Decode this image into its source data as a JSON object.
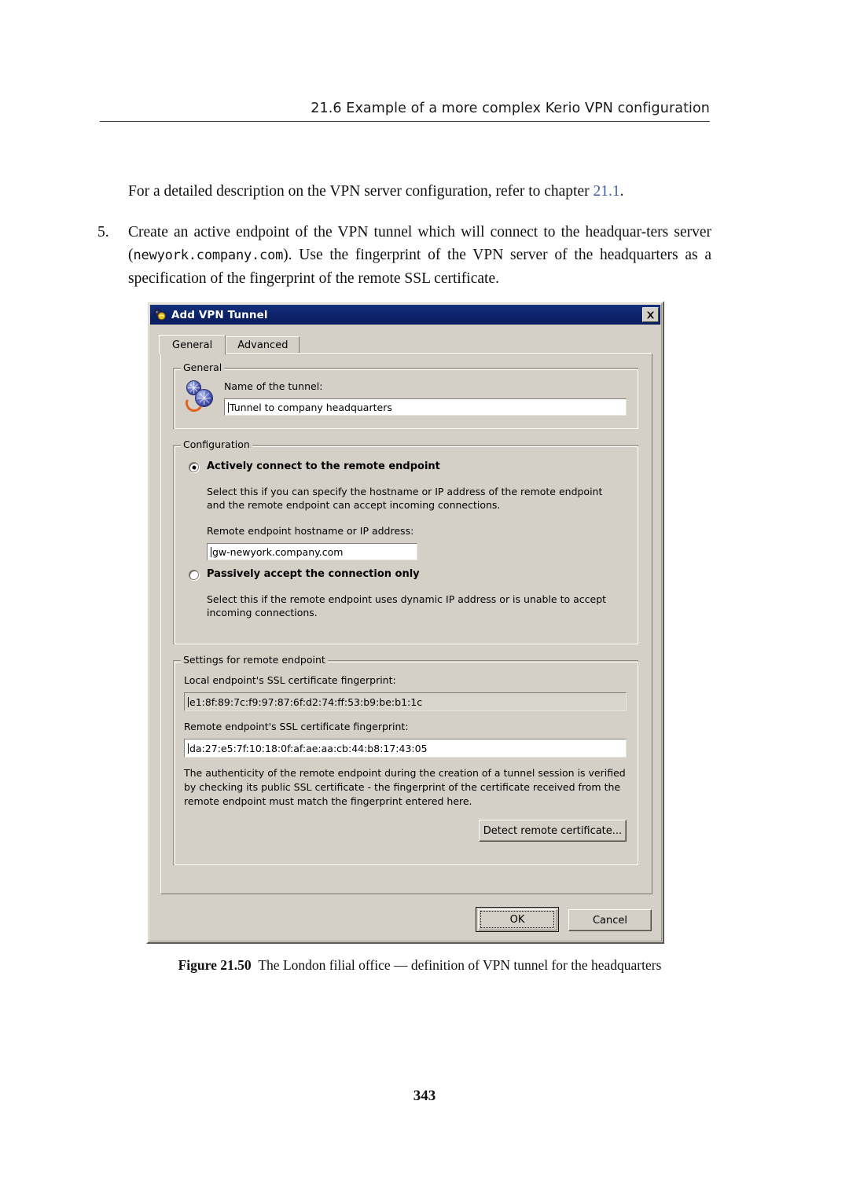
{
  "page": {
    "header": "21.6  Example of a more complex Kerio VPN configuration",
    "intro_paragraph_before": "For a detailed description on the VPN server configuration, refer to chapter ",
    "intro_xref": "21.1",
    "intro_paragraph_after": ".",
    "step_number": "5.",
    "step_text_1": "Create an active endpoint of the VPN tunnel which will connect to the headquar-ters server (",
    "step_mono_1": "newyork.company.com",
    "step_text_2": "). Use the fingerprint of the VPN server of the headquarters as a specification of the fingerprint of the remote SSL certificate.",
    "figure_label": "Figure 21.50",
    "figure_caption": "The London filial office — definition of VPN tunnel for the headquarters",
    "page_number": "343"
  },
  "dialog": {
    "title": "Add VPN Tunnel",
    "close_label": "✕",
    "tabs": [
      {
        "label": "General",
        "active": true
      },
      {
        "label": "Advanced",
        "active": false
      }
    ],
    "general_group": {
      "title": "General",
      "name_label": "Name of the tunnel:",
      "name_value": "Tunnel to company headquarters"
    },
    "configuration_group": {
      "title": "Configuration",
      "active_radio_label": "Actively connect to the remote endpoint",
      "active_radio_selected": true,
      "active_help": "Select this if you can specify the hostname or IP address of the remote endpoint and the remote endpoint can accept incoming connections.",
      "remote_host_label": "Remote endpoint hostname or IP address:",
      "remote_host_value": "gw-newyork.company.com",
      "passive_radio_label": "Passively accept the connection only",
      "passive_radio_selected": false,
      "passive_help": "Select this if the remote endpoint uses dynamic IP address or is unable to accept incoming connections."
    },
    "remote_settings_group": {
      "title": "Settings for remote endpoint",
      "local_fp_label": "Local endpoint's SSL certificate fingerprint:",
      "local_fp_value": "e1:8f:89:7c:f9:97:87:6f:d2:74:ff:53:b9:be:b1:1c",
      "remote_fp_label": "Remote endpoint's SSL certificate fingerprint:",
      "remote_fp_value": "da:27:e5:7f:10:18:0f:af:ae:aa:cb:44:b8:17:43:05",
      "note": "The authenticity of the remote endpoint during the creation of a tunnel session is verified by checking its public SSL certificate - the fingerprint of the certificate received from the remote endpoint must match the fingerprint entered here.",
      "detect_button": "Detect remote certificate..."
    },
    "buttons": {
      "ok": "OK",
      "cancel": "Cancel"
    },
    "colors": {
      "dialog_face": "#d4d0c8",
      "titlebar": "#0b2269",
      "field_background": "#ffffff",
      "readonly_field": "#d8d5cd",
      "accent_link": "#3a5f9b"
    }
  }
}
